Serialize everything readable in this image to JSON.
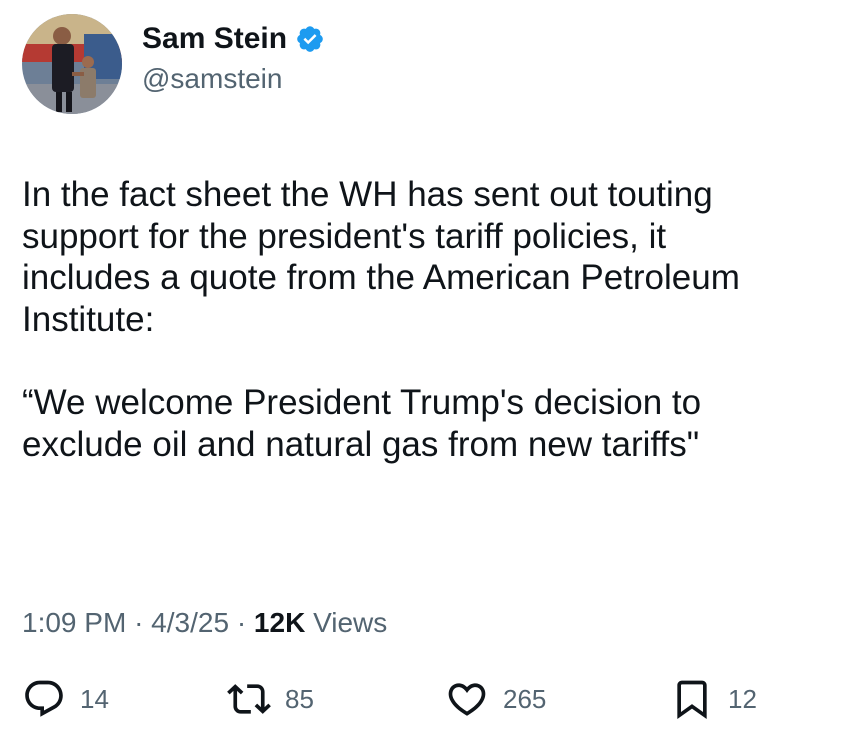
{
  "author": {
    "display_name": "Sam Stein",
    "handle": "@samstein",
    "verified": true,
    "verified_color": "#1d9bf0"
  },
  "tweet": {
    "paragraphs": [
      "In the fact sheet the WH has sent out touting\nsupport for the president's tariff policies, it\nincludes a quote from the American Petroleum\nInstitute:",
      "“We welcome President Trump's decision to\nexclude oil and natural gas from new tariffs\""
    ]
  },
  "meta": {
    "time": "1:09 PM",
    "separator": "·",
    "date": "4/3/25",
    "views_count": "12K",
    "views_label": "Views"
  },
  "actions": {
    "reply": {
      "icon": "reply-icon",
      "count": "14"
    },
    "retweet": {
      "icon": "retweet-icon",
      "count": "85"
    },
    "like": {
      "icon": "heart-icon",
      "count": "265"
    },
    "bookmark": {
      "icon": "bookmark-icon",
      "count": "12"
    }
  },
  "colors": {
    "text_primary": "#0f1419",
    "text_secondary": "#536471",
    "background": "#ffffff"
  }
}
